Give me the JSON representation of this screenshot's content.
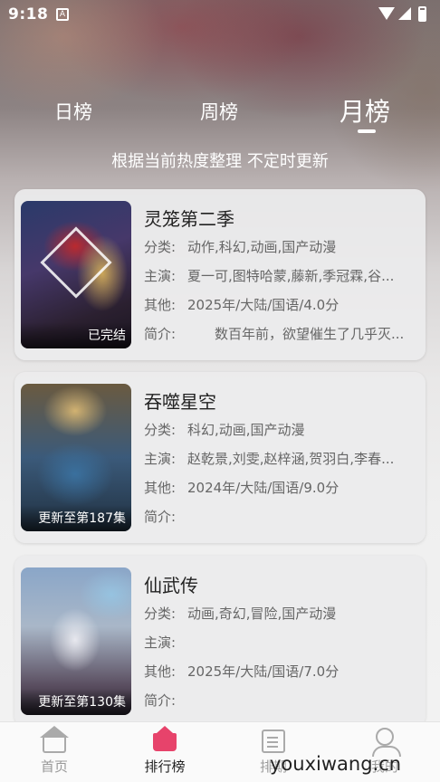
{
  "status_bar": {
    "time": "9:18",
    "notification_icon": "notification-a-icon",
    "wifi_icon": "wifi-icon",
    "signal_icon": "signal-icon",
    "battery_icon": "battery-icon"
  },
  "tabs": [
    {
      "label": "日榜",
      "active": false
    },
    {
      "label": "周榜",
      "active": false
    },
    {
      "label": "月榜",
      "active": true
    }
  ],
  "subtitle": "根据当前热度整理 不定时更新",
  "labels": {
    "category": "分类:",
    "cast": "主演:",
    "other": "其他:",
    "intro": "简介:"
  },
  "items": [
    {
      "title": "灵笼第二季",
      "badge": "已完结",
      "category": "动作,科幻,动画,国产动漫",
      "cast": "夏一可,图特哈蒙,藤新,季冠霖,谷...",
      "other": "2025年/大陆/国语/4.0分",
      "intro": "　　数百年前，欲望催生了几乎灭..."
    },
    {
      "title": "吞噬星空",
      "badge": "更新至第187集",
      "category": "科幻,动画,国产动漫",
      "cast": "赵乾景,刘雯,赵梓涵,贺羽白,李春...",
      "other": "2024年/大陆/国语/9.0分",
      "intro": ""
    },
    {
      "title": "仙武传",
      "badge": "更新至第130集",
      "category": "动画,奇幻,冒险,国产动漫",
      "cast": "",
      "other": "2025年/大陆/国语/7.0分",
      "intro": ""
    }
  ],
  "bottom_nav": [
    {
      "label": "首页",
      "icon": "home-icon"
    },
    {
      "label": "排行榜",
      "icon": "ranking-icon",
      "active": true
    },
    {
      "label": "排期",
      "icon": "schedule-icon"
    },
    {
      "label": "我的",
      "icon": "profile-icon"
    }
  ],
  "watermark": "youxiwang.cn",
  "colors": {
    "accent": "#e7436b",
    "text_primary": "#222222",
    "text_secondary": "#666666",
    "nav_inactive": "#999999"
  }
}
